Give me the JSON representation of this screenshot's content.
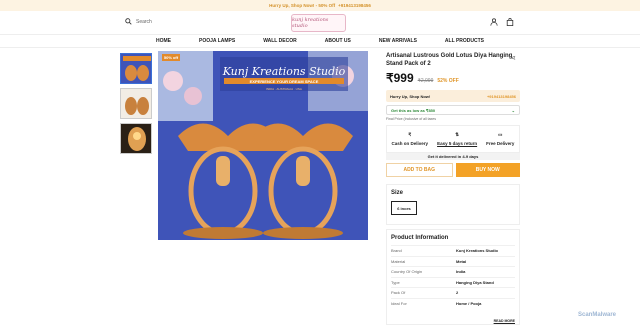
{
  "promo": {
    "text": "Hurry Up, Shop Now! - 50% Off",
    "phone": "+919413198456"
  },
  "header": {
    "search_placeholder": "Search",
    "logo_text": "kunj kreations studio"
  },
  "nav": {
    "items": [
      "HOME",
      "POOJA LAMPS",
      "WALL DECOR",
      "ABOUT US",
      "NEW ARRIVALS",
      "ALL PRODUCTS"
    ]
  },
  "gallery": {
    "badge": "50% off",
    "banner_title": "Kunj Kreations Studio",
    "banner_subtitle": "EXPERIENCE YOUR DREAM SPACE",
    "banner_small": "INDIA · AUSTRALIA · USA"
  },
  "product": {
    "title": "Artisanal Lustrous Gold Lotus Diya Hanging Stand Pack of 2",
    "price": "₹999",
    "mrp": "₹2,099",
    "discount": "52% OFF",
    "hurry_text": "Hurry Up, Shop Now!",
    "hurry_phone": "+919413198456",
    "offer_text": "Get this as low as ₹850",
    "tax_note": "Final Price (Inclusive of all taxes",
    "features": [
      {
        "icon": "rupee-icon",
        "label": "Cash on Delivery"
      },
      {
        "icon": "return-icon",
        "label": "Easy 5 days return"
      },
      {
        "icon": "truck-icon",
        "label": "Free Delivery"
      }
    ],
    "delivery_text": "Get it delivered in 4-9 days",
    "add_to_bag": "ADD TO BAG",
    "buy_now": "BUY NOW",
    "size_heading": "Size",
    "size_selected": "6 inces"
  },
  "product_info": {
    "heading": "Product Information",
    "rows": [
      {
        "key": "Brand",
        "value": "Kunj Kreations Studio"
      },
      {
        "key": "Material",
        "value": "Metal"
      },
      {
        "key": "Country Of Origin",
        "value": "India"
      },
      {
        "key": "Type",
        "value": "Hanging Diya Stand"
      },
      {
        "key": "Pack Of",
        "value": "2"
      },
      {
        "key": "Ideal For",
        "value": "Home / Pooja"
      }
    ],
    "read_more": "READ MORE"
  },
  "watermark": "ScanMalware",
  "colors": {
    "accent": "#f3a227",
    "promo_bg": "#fdf3e2",
    "image_bg": "#3f54b8"
  }
}
